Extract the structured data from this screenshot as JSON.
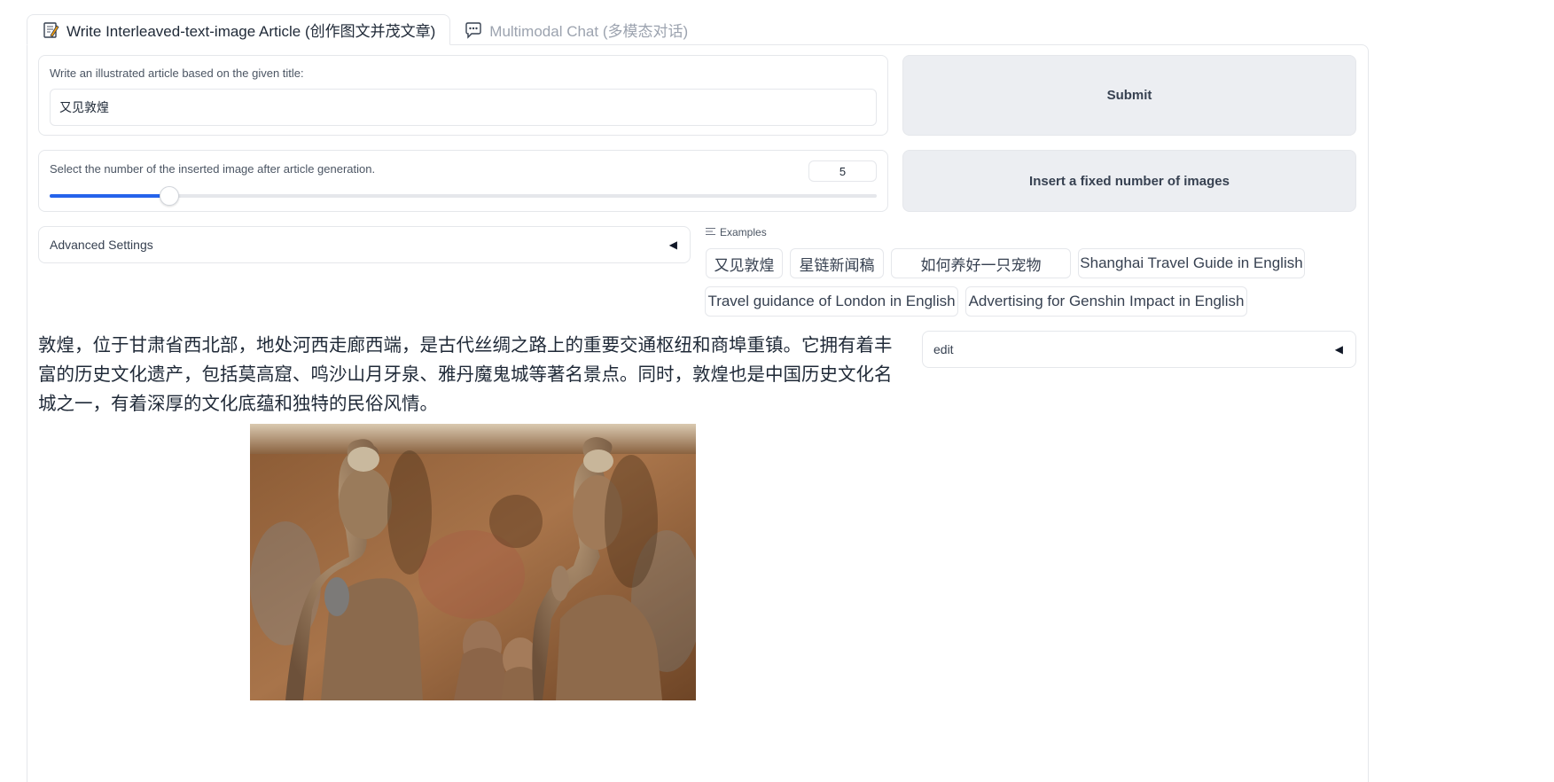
{
  "tabs": [
    {
      "label": "Write Interleaved-text-image Article (创作图文并茂文章)",
      "icon": "memo-icon",
      "active": true
    },
    {
      "label": "Multimodal Chat (多模态对话)",
      "icon": "chat-bubble-icon",
      "active": false
    }
  ],
  "title_field": {
    "label": "Write an illustrated article based on the given title:",
    "value": "又见敦煌"
  },
  "image_count": {
    "label": "Select the number of the inserted image after article generation.",
    "value": "5",
    "slider_fraction": 0.145
  },
  "buttons": {
    "submit": "Submit",
    "insert_fixed": "Insert a fixed number of images"
  },
  "advanced_settings": {
    "label": "Advanced Settings",
    "arrow": "◀"
  },
  "examples": {
    "label": "Examples",
    "icon": "list-icon",
    "items": [
      "又见敦煌",
      "星链新闻稿",
      "如何养好一只宠物",
      "Shanghai Travel Guide in English",
      "Travel guidance of London in English",
      "Advertising for Genshin Impact in English"
    ]
  },
  "edit_panel": {
    "label": "edit",
    "arrow": "◀"
  },
  "article": {
    "text": "敦煌，位于甘肃省西北部，地处河西走廊西端，是古代丝绸之路上的重要交通枢纽和商埠重镇。它拥有着丰富的历史文化遗产，包括莫高窟、鸣沙山月牙泉、雅丹魔鬼城等著名景点。同时，敦煌也是中国历史文化名城之一，有着深厚的文化底蕴和独特的民俗风情。",
    "image": "dunhuang-buddha-statues-photo"
  },
  "colors": {
    "accent": "#2563eb",
    "button_bg": "#eceef2",
    "border": "#e5e7eb"
  }
}
